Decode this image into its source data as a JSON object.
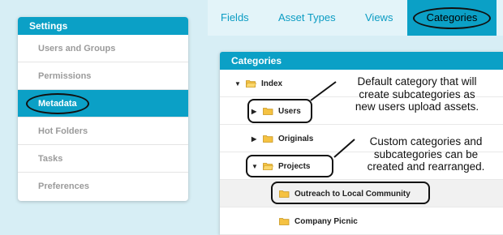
{
  "sidebar": {
    "title": "Settings",
    "items": [
      {
        "label": "Users and Groups",
        "active": false
      },
      {
        "label": "Permissions",
        "active": false
      },
      {
        "label": "Metadata",
        "active": true
      },
      {
        "label": "Hot Folders",
        "active": false
      },
      {
        "label": "Tasks",
        "active": false
      },
      {
        "label": "Preferences",
        "active": false
      }
    ]
  },
  "tabs": [
    {
      "label": "Fields"
    },
    {
      "label": "Asset Types"
    },
    {
      "label": "Views"
    },
    {
      "label": "Categories",
      "active": true
    }
  ],
  "panel": {
    "title": "Categories",
    "tree": {
      "index": "Index",
      "users": "Users",
      "originals": "Originals",
      "projects": "Projects",
      "outreach": "Outreach to Local Community",
      "picnic": "Company Picnic"
    }
  },
  "callouts": {
    "default_category": [
      "Default category that will",
      "create subcategories as",
      "new users upload assets."
    ],
    "custom_categories": [
      "Custom categories and",
      "subcategories can be",
      "created and rearranged."
    ]
  },
  "colors": {
    "accent": "#0ba0c6",
    "background": "#d7eef5",
    "tab_text": "#0b9cc3",
    "folder": "#f5c242"
  },
  "icons": {
    "folder_closed": "folder-icon",
    "folder_open": "folder-open-icon",
    "expand": "triangle-right-icon",
    "collapse": "triangle-down-icon"
  }
}
